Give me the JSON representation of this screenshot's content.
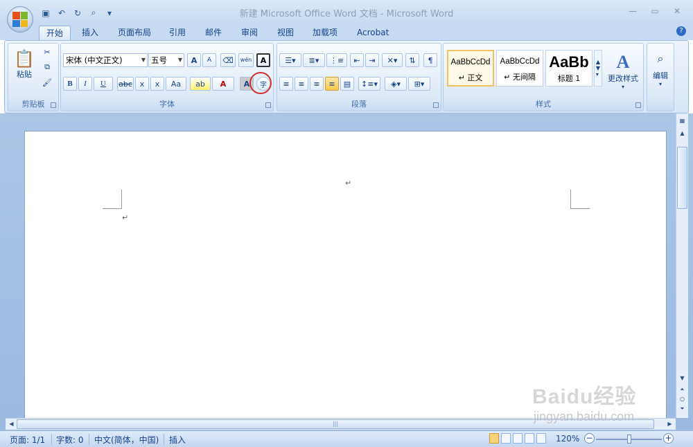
{
  "window": {
    "title": "新建 Microsoft Office Word 文档 - Microsoft Word"
  },
  "ribbon_tabs": [
    "开始",
    "插入",
    "页面布局",
    "引用",
    "邮件",
    "审阅",
    "视图",
    "加载项",
    "Acrobat"
  ],
  "clipboard": {
    "paste_label": "粘贴",
    "group_label": "剪贴板"
  },
  "font": {
    "font_name": "宋体 (中文正文)",
    "font_size": "五号",
    "group_label": "字体",
    "grow": "A",
    "shrink": "A",
    "bold": "B",
    "italic": "I",
    "underline": "U",
    "strike": "abc",
    "subscript": "x",
    "superscript": "x",
    "change_case": "Aa",
    "font_color": "A",
    "char_shading": "A",
    "phonetic": "wén",
    "enclose_char": "字"
  },
  "paragraph": {
    "group_label": "段落"
  },
  "styles": {
    "group_label": "样式",
    "items": [
      {
        "sample": "AaBbCcDd",
        "name": "↵ 正文"
      },
      {
        "sample": "AaBbCcDd",
        "name": "↵ 无间隔"
      },
      {
        "sample": "AaBb",
        "name": "标题 1"
      }
    ],
    "change_styles": "更改样式"
  },
  "editing": {
    "label": "编辑"
  },
  "document": {
    "paragraph_mark": "↵"
  },
  "statusbar": {
    "page": "页面: 1/1",
    "words": "字数: 0",
    "language": "中文(简体，中国)",
    "mode": "插入",
    "zoom": "120%"
  },
  "watermark": {
    "logo": "Baidu经验",
    "url": "jingyan.baidu.com"
  },
  "colors": {
    "accent": "#15428b",
    "ribbon": "#dbe8f7",
    "highlight_circle": "#d23030"
  }
}
